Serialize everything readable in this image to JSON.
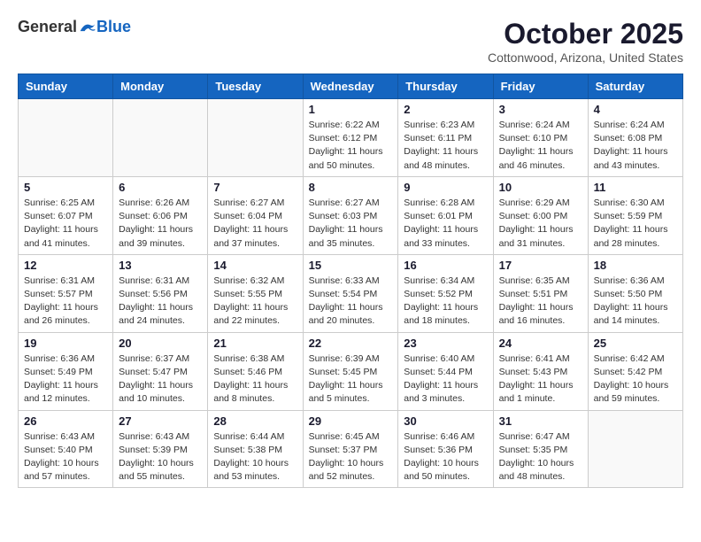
{
  "header": {
    "logo_general": "General",
    "logo_blue": "Blue",
    "title": "October 2025",
    "location": "Cottonwood, Arizona, United States"
  },
  "days_of_week": [
    "Sunday",
    "Monday",
    "Tuesday",
    "Wednesday",
    "Thursday",
    "Friday",
    "Saturday"
  ],
  "weeks": [
    [
      {
        "day": "",
        "info": ""
      },
      {
        "day": "",
        "info": ""
      },
      {
        "day": "",
        "info": ""
      },
      {
        "day": "1",
        "info": "Sunrise: 6:22 AM\nSunset: 6:12 PM\nDaylight: 11 hours and 50 minutes."
      },
      {
        "day": "2",
        "info": "Sunrise: 6:23 AM\nSunset: 6:11 PM\nDaylight: 11 hours and 48 minutes."
      },
      {
        "day": "3",
        "info": "Sunrise: 6:24 AM\nSunset: 6:10 PM\nDaylight: 11 hours and 46 minutes."
      },
      {
        "day": "4",
        "info": "Sunrise: 6:24 AM\nSunset: 6:08 PM\nDaylight: 11 hours and 43 minutes."
      }
    ],
    [
      {
        "day": "5",
        "info": "Sunrise: 6:25 AM\nSunset: 6:07 PM\nDaylight: 11 hours and 41 minutes."
      },
      {
        "day": "6",
        "info": "Sunrise: 6:26 AM\nSunset: 6:06 PM\nDaylight: 11 hours and 39 minutes."
      },
      {
        "day": "7",
        "info": "Sunrise: 6:27 AM\nSunset: 6:04 PM\nDaylight: 11 hours and 37 minutes."
      },
      {
        "day": "8",
        "info": "Sunrise: 6:27 AM\nSunset: 6:03 PM\nDaylight: 11 hours and 35 minutes."
      },
      {
        "day": "9",
        "info": "Sunrise: 6:28 AM\nSunset: 6:01 PM\nDaylight: 11 hours and 33 minutes."
      },
      {
        "day": "10",
        "info": "Sunrise: 6:29 AM\nSunset: 6:00 PM\nDaylight: 11 hours and 31 minutes."
      },
      {
        "day": "11",
        "info": "Sunrise: 6:30 AM\nSunset: 5:59 PM\nDaylight: 11 hours and 28 minutes."
      }
    ],
    [
      {
        "day": "12",
        "info": "Sunrise: 6:31 AM\nSunset: 5:57 PM\nDaylight: 11 hours and 26 minutes."
      },
      {
        "day": "13",
        "info": "Sunrise: 6:31 AM\nSunset: 5:56 PM\nDaylight: 11 hours and 24 minutes."
      },
      {
        "day": "14",
        "info": "Sunrise: 6:32 AM\nSunset: 5:55 PM\nDaylight: 11 hours and 22 minutes."
      },
      {
        "day": "15",
        "info": "Sunrise: 6:33 AM\nSunset: 5:54 PM\nDaylight: 11 hours and 20 minutes."
      },
      {
        "day": "16",
        "info": "Sunrise: 6:34 AM\nSunset: 5:52 PM\nDaylight: 11 hours and 18 minutes."
      },
      {
        "day": "17",
        "info": "Sunrise: 6:35 AM\nSunset: 5:51 PM\nDaylight: 11 hours and 16 minutes."
      },
      {
        "day": "18",
        "info": "Sunrise: 6:36 AM\nSunset: 5:50 PM\nDaylight: 11 hours and 14 minutes."
      }
    ],
    [
      {
        "day": "19",
        "info": "Sunrise: 6:36 AM\nSunset: 5:49 PM\nDaylight: 11 hours and 12 minutes."
      },
      {
        "day": "20",
        "info": "Sunrise: 6:37 AM\nSunset: 5:47 PM\nDaylight: 11 hours and 10 minutes."
      },
      {
        "day": "21",
        "info": "Sunrise: 6:38 AM\nSunset: 5:46 PM\nDaylight: 11 hours and 8 minutes."
      },
      {
        "day": "22",
        "info": "Sunrise: 6:39 AM\nSunset: 5:45 PM\nDaylight: 11 hours and 5 minutes."
      },
      {
        "day": "23",
        "info": "Sunrise: 6:40 AM\nSunset: 5:44 PM\nDaylight: 11 hours and 3 minutes."
      },
      {
        "day": "24",
        "info": "Sunrise: 6:41 AM\nSunset: 5:43 PM\nDaylight: 11 hours and 1 minute."
      },
      {
        "day": "25",
        "info": "Sunrise: 6:42 AM\nSunset: 5:42 PM\nDaylight: 10 hours and 59 minutes."
      }
    ],
    [
      {
        "day": "26",
        "info": "Sunrise: 6:43 AM\nSunset: 5:40 PM\nDaylight: 10 hours and 57 minutes."
      },
      {
        "day": "27",
        "info": "Sunrise: 6:43 AM\nSunset: 5:39 PM\nDaylight: 10 hours and 55 minutes."
      },
      {
        "day": "28",
        "info": "Sunrise: 6:44 AM\nSunset: 5:38 PM\nDaylight: 10 hours and 53 minutes."
      },
      {
        "day": "29",
        "info": "Sunrise: 6:45 AM\nSunset: 5:37 PM\nDaylight: 10 hours and 52 minutes."
      },
      {
        "day": "30",
        "info": "Sunrise: 6:46 AM\nSunset: 5:36 PM\nDaylight: 10 hours and 50 minutes."
      },
      {
        "day": "31",
        "info": "Sunrise: 6:47 AM\nSunset: 5:35 PM\nDaylight: 10 hours and 48 minutes."
      },
      {
        "day": "",
        "info": ""
      }
    ]
  ]
}
